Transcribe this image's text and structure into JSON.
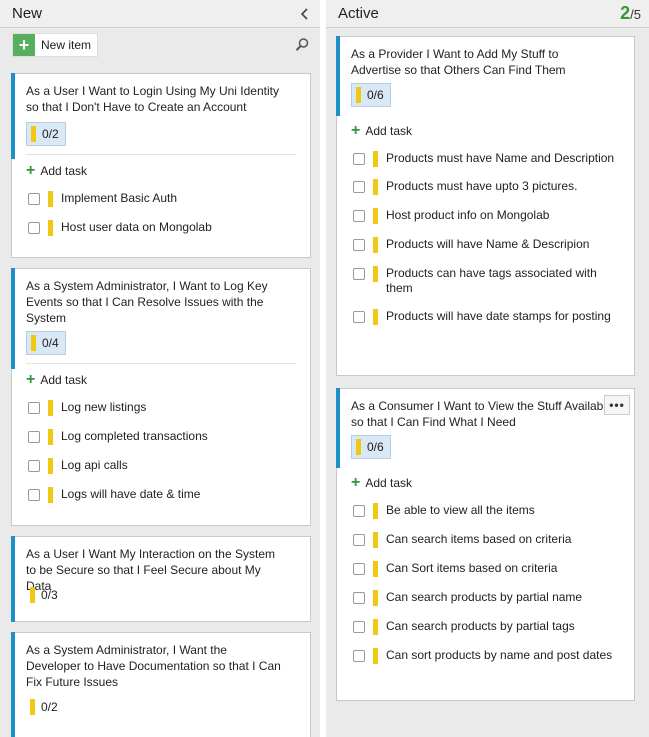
{
  "columns": {
    "new": {
      "title": "New",
      "new_item_label": "New item"
    },
    "active": {
      "title": "Active",
      "count": "2",
      "limit": "/5"
    }
  },
  "add_task_label": "Add task",
  "new_cards": [
    {
      "title": "As a User I Want to Login Using My Uni Identity so that I Don't Have to Create an Account",
      "tally": "0/2",
      "tasks": [
        "Implement Basic Auth",
        "Host user data on Mongolab"
      ]
    },
    {
      "title": "As a System Administrator, I Want to Log Key Events so that I Can Resolve Issues with the System",
      "tally": "0/4",
      "tasks": [
        "Log new listings",
        "Log completed transactions",
        "Log api calls",
        "Logs will have date & time"
      ]
    },
    {
      "title": "As a User I Want My Interaction on the System to be Secure so that I Feel Secure about My Data",
      "tally": "0/3",
      "tasks": []
    },
    {
      "title": "As a System Administrator, I Want the Developer to Have Documentation so that I Can Fix Future Issues",
      "tally": "0/2",
      "tasks": []
    }
  ],
  "active_cards": [
    {
      "title": "As a Provider I Want to Add My Stuff to Advertise so that Others Can Find Them",
      "tally": "0/6",
      "tasks": [
        "Products must have Name and Description",
        "Products must have upto 3 pictures.",
        "Host product info on Mongolab",
        "Products will have Name & Descripion",
        "Products can have tags associated with them",
        "Products will have date stamps for posting"
      ]
    },
    {
      "title": "As a Consumer I Want to View the Stuff Available so that I Can Find What I Need",
      "tally": "0/6",
      "tasks": [
        "Be able to view all the items",
        "Can search items based on criteria",
        "Can Sort items based on criteria",
        "Can search products by partial name",
        "Can search products by partial tags",
        "Can sort products by name and post dates"
      ]
    }
  ],
  "colors": {
    "card_accent": "#1e90c8",
    "task_marker": "#f0c814",
    "count_ok": "#339933",
    "add_green": "#2e9a3a"
  },
  "icons": [
    "collapse-left-icon",
    "plus-icon",
    "search-icon",
    "more-icon"
  ]
}
